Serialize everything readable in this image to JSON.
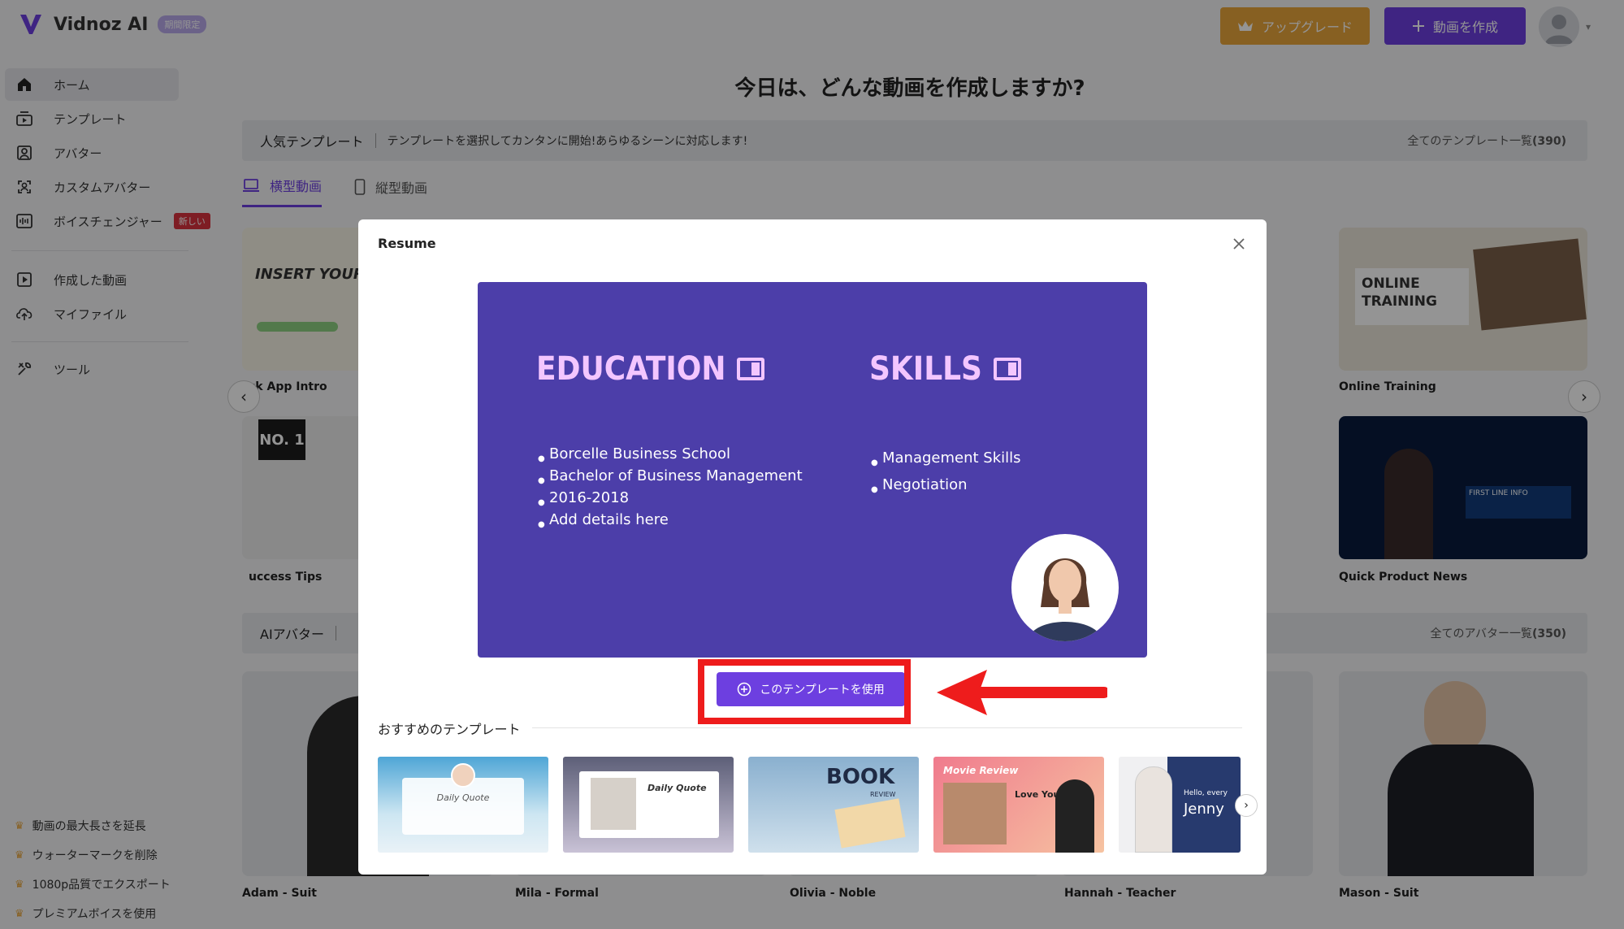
{
  "header": {
    "logo_text": "Vidnoz AI",
    "plan_badge": "期間限定",
    "upgrade_label": "アップグレード",
    "create_label": "動画を作成"
  },
  "sidebar": {
    "items": [
      {
        "label": "ホーム",
        "icon": "home-icon"
      },
      {
        "label": "テンプレート",
        "icon": "template-icon"
      },
      {
        "label": "アバター",
        "icon": "avatar-icon"
      },
      {
        "label": "カスタムアバター",
        "icon": "custom-avatar-icon"
      },
      {
        "label": "ボイスチェンジャー",
        "icon": "voice-changer-icon",
        "badge": "新しい"
      },
      {
        "label": "作成した動画",
        "icon": "video-icon"
      },
      {
        "label": "マイファイル",
        "icon": "upload-icon"
      },
      {
        "label": "ツール",
        "icon": "tools-icon"
      }
    ],
    "perks": [
      "動画の最大長さを延長",
      "ウォーターマークを削除",
      "1080p品質でエクスポート",
      "プレミアムボイスを使用"
    ]
  },
  "main": {
    "title": "今日は、どんな動画を作成しますか?",
    "templates_section": {
      "title": "人気テンプレート",
      "description": "テンプレートを選択してカンタンに開始!あらゆるシーンに対応します!",
      "link": "全てのテンプレート一覧",
      "count": "(390)"
    },
    "tabs": [
      "横型動画",
      "縦型動画"
    ],
    "template_cards": [
      {
        "label": "ck App Intro",
        "text": "INSERT YOUR TITLE."
      },
      {
        "label": "Online Training",
        "text": "ONLINE TRAINING"
      },
      {
        "label": "uccess Tips",
        "text": "NO. 1"
      },
      {
        "label": "Quick Product News",
        "text": "FIRST LINE INFO"
      }
    ],
    "avatars_section": {
      "title": "AIアバター",
      "link": "全てのアバター一覧",
      "count": "(350)"
    },
    "avatars": [
      "Adam - Suit",
      "Mila - Formal",
      "Olivia - Noble",
      "Hannah - Teacher",
      "Mason - Suit"
    ]
  },
  "modal": {
    "title": "Resume",
    "preview": {
      "education_heading": "EDUCATION",
      "education_items": [
        "Borcelle Business School",
        "Bachelor of Business Management",
        "2016-2018",
        "Add details here"
      ],
      "skills_heading": "SKILLS",
      "skills_items": [
        "Management Skills",
        "Negotiation"
      ]
    },
    "use_button": "このテンプレートを使用",
    "recommended_title": "おすすめのテンプレート",
    "recommended": [
      {
        "text": "Daily Quote"
      },
      {
        "text": "Daily Quote"
      },
      {
        "text": "BOOK",
        "sub": "REVIEW"
      },
      {
        "text": "Movie Review",
        "sub": "Love You"
      },
      {
        "text": "Hello, every",
        "sub": "Jenny"
      }
    ]
  },
  "colors": {
    "accent": "#6d3fe0",
    "upgrade": "#e9a53b",
    "preview_bg": "#4c3ea9",
    "highlight": "#ee1c1c"
  }
}
